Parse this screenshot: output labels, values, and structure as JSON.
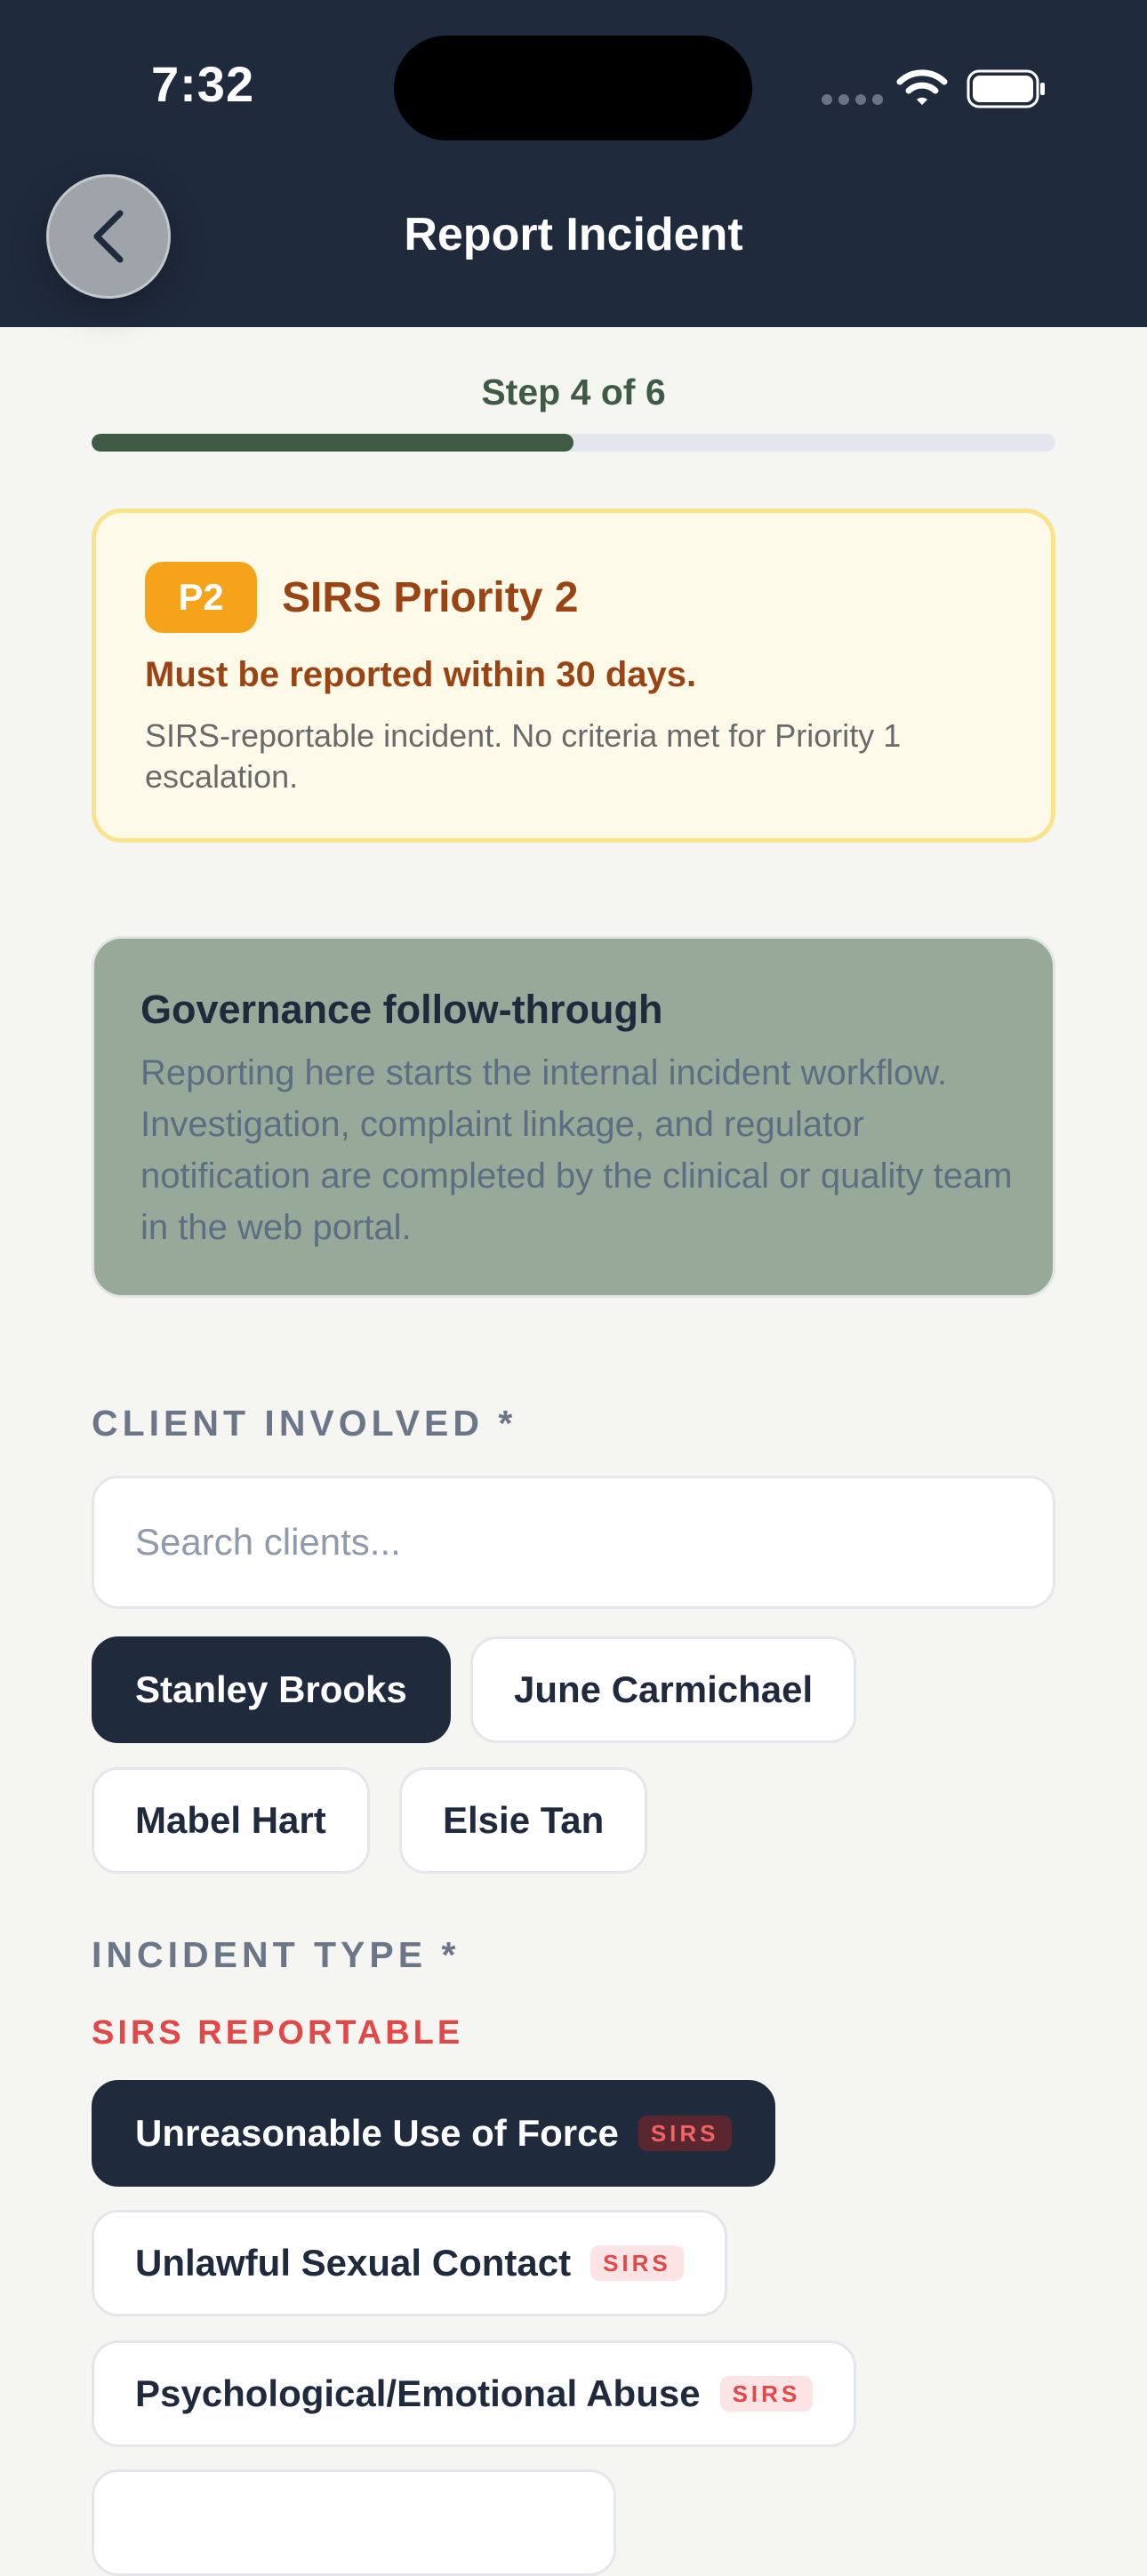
{
  "status_bar": {
    "time": "7:32"
  },
  "header": {
    "title": "Report Incident",
    "back_icon": "chevron-left-icon"
  },
  "progress": {
    "step_label": "Step 4 of 6",
    "current": 4,
    "total": 6,
    "fraction": 0.5,
    "color": "#3f5a45"
  },
  "priority_card": {
    "badge": "P2",
    "title": "SIRS Priority 2",
    "subtitle": "Must be reported within 30 days.",
    "description": "SIRS-reportable incident. No criteria met for Priority 1 escalation.",
    "accent_color": "#f4a31a"
  },
  "governance_card": {
    "title": "Governance follow-through",
    "body": "Reporting here starts the internal incident workflow. Investigation, complaint linkage, and regulator notification are completed by the clinical or quality team in the web portal."
  },
  "client_section": {
    "label": "CLIENT INVOLVED *",
    "search_placeholder": "Search clients...",
    "clients": [
      {
        "name": "Stanley Brooks",
        "selected": true
      },
      {
        "name": "June Carmichael",
        "selected": false
      },
      {
        "name": "Mabel Hart",
        "selected": false
      },
      {
        "name": "Elsie Tan",
        "selected": false
      }
    ]
  },
  "incident_section": {
    "label": "INCIDENT TYPE *",
    "group_label": "SIRS REPORTABLE",
    "types": [
      {
        "name": "Unreasonable Use of Force",
        "tag": "SIRS",
        "selected": true
      },
      {
        "name": "Unlawful Sexual Contact",
        "tag": "SIRS",
        "selected": false
      },
      {
        "name": "Psychological/Emotional Abuse",
        "tag": "SIRS",
        "selected": false
      }
    ]
  }
}
